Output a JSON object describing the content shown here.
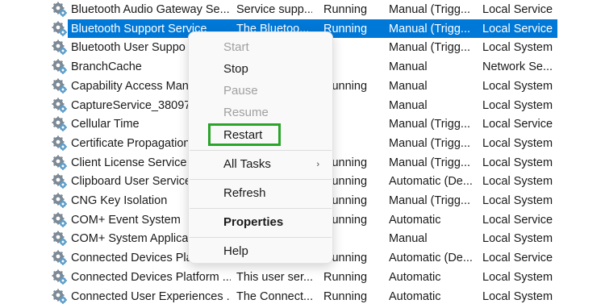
{
  "services": [
    {
      "name": "Bluetooth Audio Gateway Se...",
      "description": "Service supp...",
      "status": "Running",
      "startup": "Manual (Trigg...",
      "logon": "Local Service",
      "selected": false
    },
    {
      "name": "Bluetooth Support Service",
      "description": "The Bluetoo...",
      "status": "Running",
      "startup": "Manual (Trigg...",
      "logon": "Local Service",
      "selected": true
    },
    {
      "name": "Bluetooth User Suppo",
      "description": "",
      "status": "",
      "startup": "Manual (Trigg...",
      "logon": "Local System",
      "selected": false
    },
    {
      "name": "BranchCache",
      "description": "",
      "status": "",
      "startup": "Manual",
      "logon": "Network Se...",
      "selected": false
    },
    {
      "name": "Capability Access Mana",
      "description": "",
      "status": "Running",
      "startup": "Manual",
      "logon": "Local System",
      "selected": false
    },
    {
      "name": "CaptureService_380977",
      "description": "",
      "status": "",
      "startup": "Manual",
      "logon": "Local System",
      "selected": false
    },
    {
      "name": "Cellular Time",
      "description": "",
      "status": "",
      "startup": "Manual (Trigg...",
      "logon": "Local Service",
      "selected": false
    },
    {
      "name": "Certificate Propagation",
      "description": "",
      "status": "",
      "startup": "Manual (Trigg...",
      "logon": "Local System",
      "selected": false
    },
    {
      "name": "Client License Service (",
      "description": "",
      "status": "Running",
      "startup": "Manual (Trigg...",
      "logon": "Local System",
      "selected": false
    },
    {
      "name": "Clipboard User Service",
      "description": "",
      "status": "Running",
      "startup": "Automatic (De...",
      "logon": "Local System",
      "selected": false
    },
    {
      "name": "CNG Key Isolation",
      "description": "",
      "status": "Running",
      "startup": "Manual (Trigg...",
      "logon": "Local System",
      "selected": false
    },
    {
      "name": "COM+ Event System",
      "description": "",
      "status": "Running",
      "startup": "Automatic",
      "logon": "Local Service",
      "selected": false
    },
    {
      "name": "COM+ System Applica",
      "description": "",
      "status": "",
      "startup": "Manual",
      "logon": "Local System",
      "selected": false
    },
    {
      "name": "Connected Devices Pla",
      "description": "",
      "status": "Running",
      "startup": "Automatic (De...",
      "logon": "Local Service",
      "selected": false
    },
    {
      "name": "Connected Devices Platform ...",
      "description": "This user ser...",
      "status": "Running",
      "startup": "Automatic",
      "logon": "Local System",
      "selected": false
    },
    {
      "name": "Connected User Experiences ...",
      "description": "The Connect...",
      "status": "Running",
      "startup": "Automatic",
      "logon": "Local System",
      "selected": false
    }
  ],
  "context_menu": {
    "start": "Start",
    "stop": "Stop",
    "pause": "Pause",
    "resume": "Resume",
    "restart": "Restart",
    "all_tasks": "All Tasks",
    "submenu_arrow": "›",
    "refresh": "Refresh",
    "properties": "Properties",
    "help": "Help"
  },
  "colors": {
    "selection": "#0078d7",
    "highlight_box": "#2aa52a"
  },
  "icons": {
    "service": "gear-icon"
  }
}
